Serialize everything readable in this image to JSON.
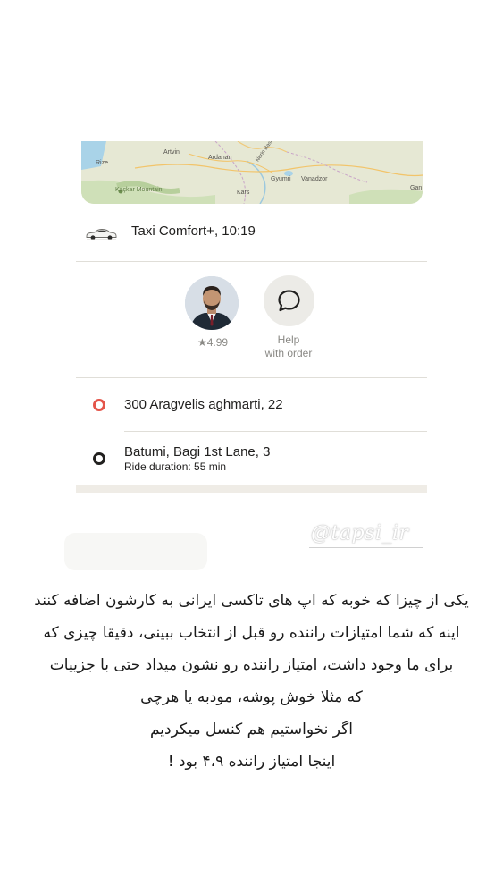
{
  "map": {
    "labels": [
      "Rize",
      "Artvin",
      "Ardahan",
      "Gyumri",
      "Vanadzor",
      "Kaçkar Mountain",
      "Kars",
      "Gan",
      "Nerin Basun"
    ]
  },
  "ride": {
    "tariff_label": "Taxi Comfort+, 10:19"
  },
  "driver": {
    "rating": "★4.99"
  },
  "help": {
    "label_line1": "Help",
    "label_line2": "with order"
  },
  "route": {
    "from": "300 Aragvelis aghmarti, 22",
    "to": "Batumi, Bagi 1st Lane, 3",
    "duration": "Ride duration: 55 min"
  },
  "watermark": "@tapsi_ir",
  "caption": {
    "lines": [
      "یکی از چیزا که خوبه که اپ های تاکسی  ایرانی به کارشون اضافه کنند",
      "اینه که شما امتیازات راننده رو قبل از انتخاب ببینی، دقیقا چیزی که",
      "برای ما وجود داشت، امتیاز راننده رو نشون میداد حتی با جزییات",
      "که مثلا خوش پوشه، مودبه یا هرچی",
      "اگر نخواستیم هم کنسل میکردیم",
      "اینجا امتیاز راننده ۴،۹ بود !"
    ]
  },
  "colors": {
    "from_dot": "#e4554a",
    "to_dot": "#21201f",
    "help_bg": "#ecebe7"
  }
}
